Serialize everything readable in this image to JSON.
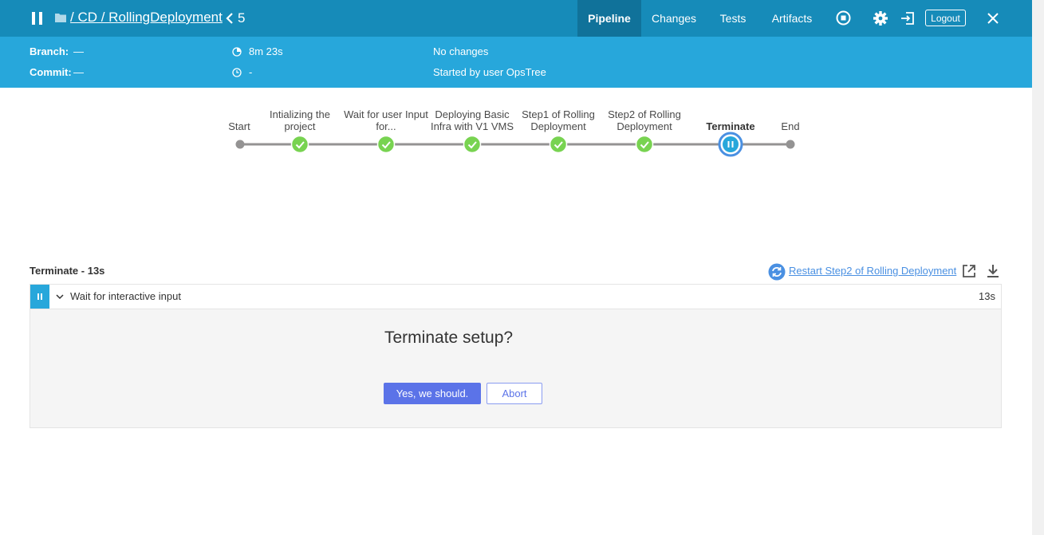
{
  "header": {
    "breadcrumb": "/ CD / RollingDeployment",
    "run_number": "5",
    "tabs": [
      {
        "label": "Pipeline",
        "active": true
      },
      {
        "label": "Changes",
        "active": false
      },
      {
        "label": "Tests",
        "active": false
      },
      {
        "label": "Artifacts",
        "active": false
      }
    ],
    "logout_label": "Logout",
    "icons": [
      "pause-icon",
      "folder-icon",
      "chevron-left-icon",
      "stop-icon",
      "gear-icon",
      "exit-icon",
      "close-icon"
    ]
  },
  "summary": {
    "branch_label": "Branch:",
    "branch_value": "—",
    "commit_label": "Commit:",
    "commit_value": "—",
    "duration": "8m 23s",
    "time_ago": "-",
    "changes": "No changes",
    "cause": "Started by user OpsTree"
  },
  "pipeline": {
    "stages": [
      {
        "label": "Start",
        "status": "none"
      },
      {
        "label": "Intializing the project",
        "status": "success"
      },
      {
        "label": "Wait for user Input for...",
        "status": "success"
      },
      {
        "label": "Deploying Basic Infra with V1 VMS",
        "status": "success"
      },
      {
        "label": "Step1 of Rolling Deployment",
        "status": "success"
      },
      {
        "label": "Step2 of Rolling Deployment",
        "status": "success"
      },
      {
        "label": "Terminate",
        "status": "paused"
      },
      {
        "label": "End",
        "status": "none"
      }
    ],
    "colors": {
      "success": "#78d351",
      "paused": "#27a7db",
      "line": "#949393"
    }
  },
  "step_panel": {
    "title": "Terminate - 13s",
    "restart_label": "Restart Step2 of Rolling Deployment",
    "step": {
      "label": "Wait for interactive input",
      "duration": "13s"
    },
    "input": {
      "message": "Terminate setup?",
      "proceed_label": "Yes, we should.",
      "abort_label": "Abort"
    }
  }
}
